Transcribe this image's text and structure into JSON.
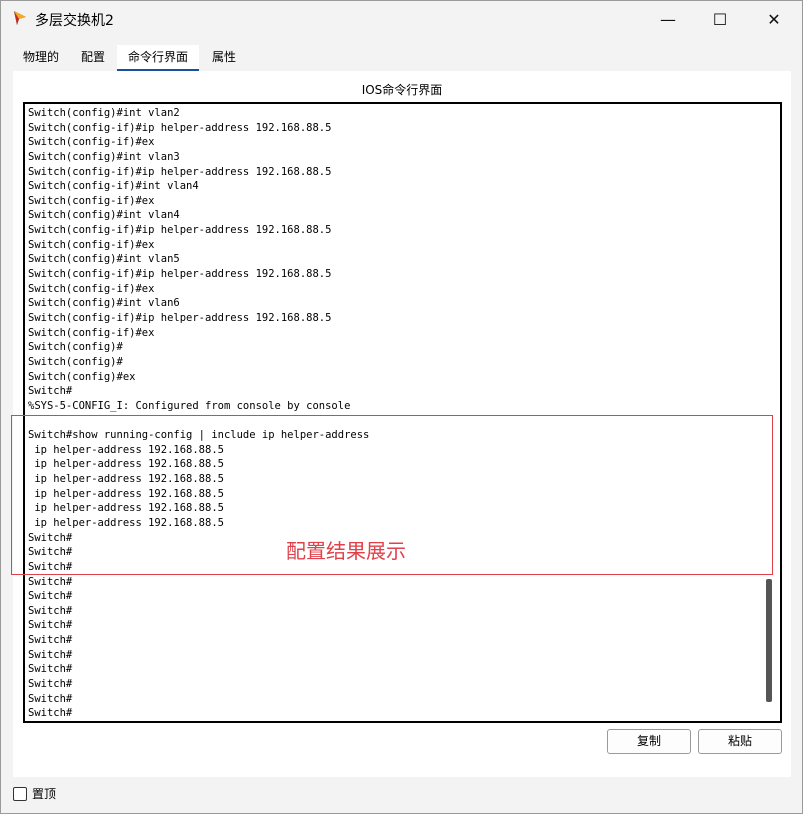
{
  "window": {
    "title": "多层交换机2",
    "controls": {
      "minimize": "—",
      "maximize": "☐",
      "close": "✕"
    }
  },
  "tabs": [
    {
      "label": "物理的"
    },
    {
      "label": "配置"
    },
    {
      "label": "命令行界面",
      "active": true
    },
    {
      "label": "属性"
    }
  ],
  "panel": {
    "title": "IOS命令行界面"
  },
  "terminal": {
    "lines": [
      "Switch(config)#int vlan2",
      "Switch(config-if)#ip helper-address 192.168.88.5",
      "Switch(config-if)#ex",
      "Switch(config)#int vlan3",
      "Switch(config-if)#ip helper-address 192.168.88.5",
      "Switch(config-if)#int vlan4",
      "Switch(config-if)#ex",
      "Switch(config)#int vlan4",
      "Switch(config-if)#ip helper-address 192.168.88.5",
      "Switch(config-if)#ex",
      "Switch(config)#int vlan5",
      "Switch(config-if)#ip helper-address 192.168.88.5",
      "Switch(config-if)#ex",
      "Switch(config)#int vlan6",
      "Switch(config-if)#ip helper-address 192.168.88.5",
      "Switch(config-if)#ex",
      "Switch(config)#",
      "Switch(config)#",
      "Switch(config)#ex",
      "Switch#",
      "%SYS-5-CONFIG_I: Configured from console by console",
      "",
      "Switch#show running-config | include ip helper-address",
      " ip helper-address 192.168.88.5",
      " ip helper-address 192.168.88.5",
      " ip helper-address 192.168.88.5",
      " ip helper-address 192.168.88.5",
      " ip helper-address 192.168.88.5",
      " ip helper-address 192.168.88.5",
      "Switch#",
      "Switch#",
      "Switch#",
      "Switch#",
      "Switch#",
      "Switch#",
      "Switch#",
      "Switch#",
      "Switch#",
      "Switch#",
      "Switch#",
      "Switch#",
      "Switch#"
    ]
  },
  "annotation": {
    "text": "配置结果展示",
    "color": "#e0414a"
  },
  "buttons": {
    "copy": "复制",
    "paste": "粘贴"
  },
  "pin": {
    "label": "置顶",
    "checked": false
  }
}
